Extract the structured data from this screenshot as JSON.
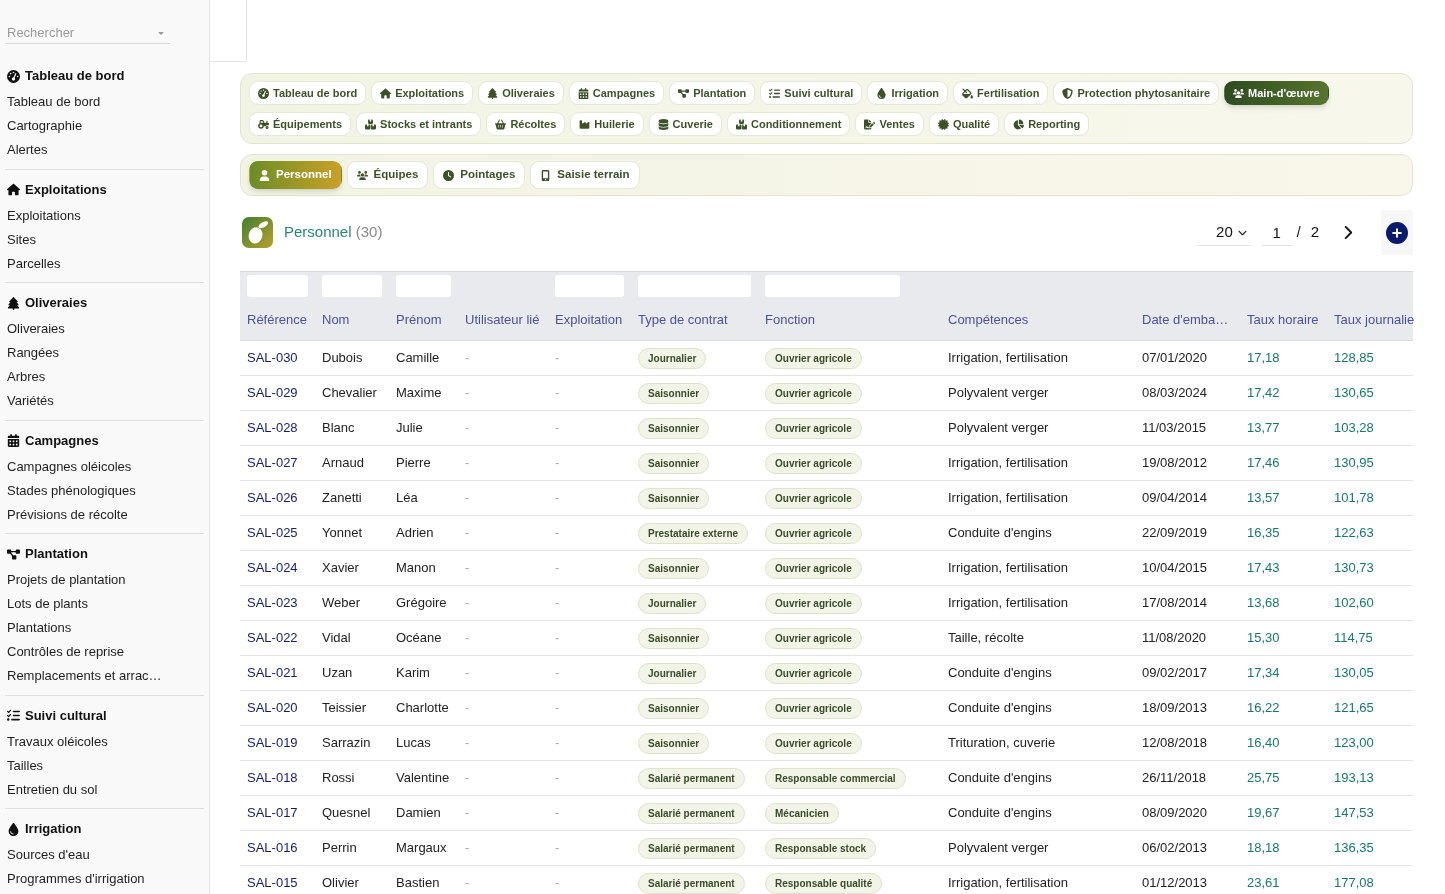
{
  "sidebar": {
    "search": {
      "placeholder": "Rechercher"
    },
    "sections": [
      {
        "title": "Tableau de bord",
        "items": [
          {
            "label": "Tableau de bord"
          },
          {
            "label": "Cartographie"
          },
          {
            "label": "Alertes"
          }
        ]
      },
      {
        "title": "Exploitations",
        "items": [
          {
            "label": "Exploitations"
          },
          {
            "label": "Sites"
          },
          {
            "label": "Parcelles"
          }
        ]
      },
      {
        "title": "Oliveraies",
        "items": [
          {
            "label": "Oliveraies"
          },
          {
            "label": "Rangées"
          },
          {
            "label": "Arbres"
          },
          {
            "label": "Variétés"
          }
        ]
      },
      {
        "title": "Campagnes",
        "items": [
          {
            "label": "Campagnes oléicoles"
          },
          {
            "label": "Stades phénologiques"
          },
          {
            "label": "Prévisions de récolte"
          }
        ]
      },
      {
        "title": "Plantation",
        "items": [
          {
            "label": "Projets de plantation"
          },
          {
            "label": "Lots de plants"
          },
          {
            "label": "Plantations"
          },
          {
            "label": "Contrôles de reprise"
          },
          {
            "label": "Remplacements et arrac…"
          }
        ]
      },
      {
        "title": "Suivi cultural",
        "items": [
          {
            "label": "Travaux oléicoles"
          },
          {
            "label": "Tailles"
          },
          {
            "label": "Entretien du sol"
          }
        ]
      },
      {
        "title": "Irrigation",
        "items": [
          {
            "label": "Sources d'eau"
          },
          {
            "label": "Programmes d'irrigation"
          }
        ]
      }
    ]
  },
  "module_nav": [
    {
      "label": "Tableau de bord",
      "selected": false
    },
    {
      "label": "Exploitations",
      "selected": false
    },
    {
      "label": "Oliveraies",
      "selected": false
    },
    {
      "label": "Campagnes",
      "selected": false
    },
    {
      "label": "Plantation",
      "selected": false
    },
    {
      "label": "Suivi cultural",
      "selected": false
    },
    {
      "label": "Irrigation",
      "selected": false
    },
    {
      "label": "Fertilisation",
      "selected": false
    },
    {
      "label": "Protection phytosanitaire",
      "selected": false
    },
    {
      "label": "Main-d'œuvre",
      "selected": true
    },
    {
      "label": "Équipements",
      "selected": false
    },
    {
      "label": "Stocks et intrants",
      "selected": false
    },
    {
      "label": "Récoltes",
      "selected": false
    },
    {
      "label": "Huilerie",
      "selected": false
    },
    {
      "label": "Cuverie",
      "selected": false
    },
    {
      "label": "Conditionnement",
      "selected": false
    },
    {
      "label": "Ventes",
      "selected": false
    },
    {
      "label": "Qualité",
      "selected": false
    },
    {
      "label": "Reporting",
      "selected": false
    }
  ],
  "sub_nav": [
    {
      "label": "Personnel",
      "selected": true
    },
    {
      "label": "Équipes",
      "selected": false
    },
    {
      "label": "Pointages",
      "selected": false
    },
    {
      "label": "Saisie terrain",
      "selected": false
    }
  ],
  "list_header": {
    "title": "Personnel",
    "count": "(30)",
    "page_size": "20",
    "page": "1",
    "separator": "/",
    "page_count": "2"
  },
  "table": {
    "columns": [
      {
        "label": "Référence",
        "filter": true
      },
      {
        "label": "Nom",
        "filter": true
      },
      {
        "label": "Prénom",
        "filter": true
      },
      {
        "label": "Utilisateur lié",
        "filter": false
      },
      {
        "label": "Exploitation",
        "filter": true
      },
      {
        "label": "Type de contrat",
        "filter": true
      },
      {
        "label": "Fonction",
        "filter": true
      },
      {
        "label": "Compétences",
        "filter": false
      },
      {
        "label": "Date d'emba…",
        "filter": false
      },
      {
        "label": "Taux horaire",
        "filter": false
      },
      {
        "label": "Taux journalie",
        "filter": false
      }
    ],
    "rows": [
      {
        "reference": "SAL-030",
        "nom": "Dubois",
        "prenom": "Camille",
        "utilisateur_lie": "-",
        "exploitation": "-",
        "type_de_contrat": "Journalier",
        "fonction": "Ouvrier agricole",
        "competences": "Irrigation, fertilisation",
        "date": "07/01/2020",
        "taux_horaire": "17,18",
        "taux_journalier": "128,85"
      },
      {
        "reference": "SAL-029",
        "nom": "Chevalier",
        "prenom": "Maxime",
        "utilisateur_lie": "-",
        "exploitation": "-",
        "type_de_contrat": "Saisonnier",
        "fonction": "Ouvrier agricole",
        "competences": "Polyvalent verger",
        "date": "08/03/2024",
        "taux_horaire": "17,42",
        "taux_journalier": "130,65"
      },
      {
        "reference": "SAL-028",
        "nom": "Blanc",
        "prenom": "Julie",
        "utilisateur_lie": "-",
        "exploitation": "-",
        "type_de_contrat": "Saisonnier",
        "fonction": "Ouvrier agricole",
        "competences": "Polyvalent verger",
        "date": "11/03/2015",
        "taux_horaire": "13,77",
        "taux_journalier": "103,28"
      },
      {
        "reference": "SAL-027",
        "nom": "Arnaud",
        "prenom": "Pierre",
        "utilisateur_lie": "-",
        "exploitation": "-",
        "type_de_contrat": "Saisonnier",
        "fonction": "Ouvrier agricole",
        "competences": "Irrigation, fertilisation",
        "date": "19/08/2012",
        "taux_horaire": "17,46",
        "taux_journalier": "130,95"
      },
      {
        "reference": "SAL-026",
        "nom": "Zanetti",
        "prenom": "Léa",
        "utilisateur_lie": "-",
        "exploitation": "-",
        "type_de_contrat": "Saisonnier",
        "fonction": "Ouvrier agricole",
        "competences": "Irrigation, fertilisation",
        "date": "09/04/2014",
        "taux_horaire": "13,57",
        "taux_journalier": "101,78"
      },
      {
        "reference": "SAL-025",
        "nom": "Yonnet",
        "prenom": "Adrien",
        "utilisateur_lie": "-",
        "exploitation": "-",
        "type_de_contrat": "Prestataire externe",
        "fonction": "Ouvrier agricole",
        "competences": "Conduite d'engins",
        "date": "22/09/2019",
        "taux_horaire": "16,35",
        "taux_journalier": "122,63"
      },
      {
        "reference": "SAL-024",
        "nom": "Xavier",
        "prenom": "Manon",
        "utilisateur_lie": "-",
        "exploitation": "-",
        "type_de_contrat": "Saisonnier",
        "fonction": "Ouvrier agricole",
        "competences": "Irrigation, fertilisation",
        "date": "10/04/2015",
        "taux_horaire": "17,43",
        "taux_journalier": "130,73"
      },
      {
        "reference": "SAL-023",
        "nom": "Weber",
        "prenom": "Grégoire",
        "utilisateur_lie": "-",
        "exploitation": "-",
        "type_de_contrat": "Journalier",
        "fonction": "Ouvrier agricole",
        "competences": "Irrigation, fertilisation",
        "date": "17/08/2014",
        "taux_horaire": "13,68",
        "taux_journalier": "102,60"
      },
      {
        "reference": "SAL-022",
        "nom": "Vidal",
        "prenom": "Océane",
        "utilisateur_lie": "-",
        "exploitation": "-",
        "type_de_contrat": "Saisonnier",
        "fonction": "Ouvrier agricole",
        "competences": "Taille, récolte",
        "date": "11/08/2020",
        "taux_horaire": "15,30",
        "taux_journalier": "114,75"
      },
      {
        "reference": "SAL-021",
        "nom": "Uzan",
        "prenom": "Karim",
        "utilisateur_lie": "-",
        "exploitation": "-",
        "type_de_contrat": "Journalier",
        "fonction": "Ouvrier agricole",
        "competences": "Conduite d'engins",
        "date": "09/02/2017",
        "taux_horaire": "17,34",
        "taux_journalier": "130,05"
      },
      {
        "reference": "SAL-020",
        "nom": "Teissier",
        "prenom": "Charlotte",
        "utilisateur_lie": "-",
        "exploitation": "-",
        "type_de_contrat": "Saisonnier",
        "fonction": "Ouvrier agricole",
        "competences": "Conduite d'engins",
        "date": "18/09/2013",
        "taux_horaire": "16,22",
        "taux_journalier": "121,65"
      },
      {
        "reference": "SAL-019",
        "nom": "Sarrazin",
        "prenom": "Lucas",
        "utilisateur_lie": "-",
        "exploitation": "-",
        "type_de_contrat": "Saisonnier",
        "fonction": "Ouvrier agricole",
        "competences": "Trituration, cuverie",
        "date": "12/08/2018",
        "taux_horaire": "16,40",
        "taux_journalier": "123,00"
      },
      {
        "reference": "SAL-018",
        "nom": "Rossi",
        "prenom": "Valentine",
        "utilisateur_lie": "-",
        "exploitation": "-",
        "type_de_contrat": "Salarié permanent",
        "fonction": "Responsable commercial",
        "competences": "Conduite d'engins",
        "date": "26/11/2018",
        "taux_horaire": "25,75",
        "taux_journalier": "193,13"
      },
      {
        "reference": "SAL-017",
        "nom": "Quesnel",
        "prenom": "Damien",
        "utilisateur_lie": "-",
        "exploitation": "-",
        "type_de_contrat": "Salarié permanent",
        "fonction": "Mécanicien",
        "competences": "Conduite d'engins",
        "date": "08/09/2020",
        "taux_horaire": "19,67",
        "taux_journalier": "147,53"
      },
      {
        "reference": "SAL-016",
        "nom": "Perrin",
        "prenom": "Margaux",
        "utilisateur_lie": "-",
        "exploitation": "-",
        "type_de_contrat": "Salarié permanent",
        "fonction": "Responsable stock",
        "competences": "Polyvalent verger",
        "date": "06/02/2013",
        "taux_horaire": "18,18",
        "taux_journalier": "136,35"
      },
      {
        "reference": "SAL-015",
        "nom": "Olivier",
        "prenom": "Bastien",
        "utilisateur_lie": "-",
        "exploitation": "-",
        "type_de_contrat": "Salarié permanent",
        "fonction": "Responsable qualité",
        "competences": "Irrigation, fertilisation",
        "date": "01/12/2013",
        "taux_horaire": "23,61",
        "taux_journalier": "177,08"
      }
    ]
  }
}
